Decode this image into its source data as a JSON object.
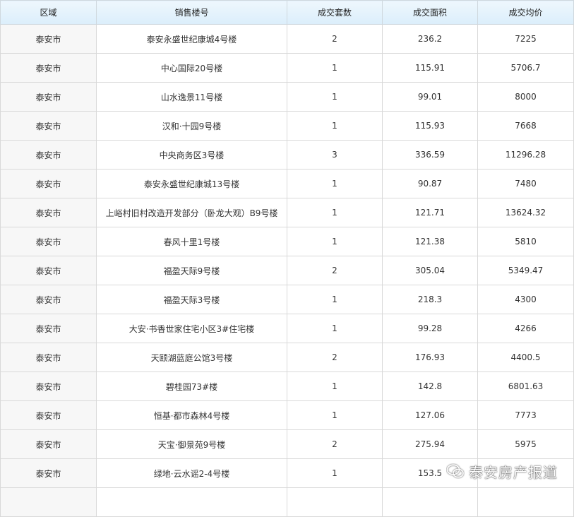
{
  "table": {
    "headers": [
      "区域",
      "销售楼号",
      "成交套数",
      "成交面积",
      "成交均价"
    ],
    "rows": [
      [
        "泰安市",
        "泰安永盛世纪康城4号楼",
        "2",
        "236.2",
        "7225"
      ],
      [
        "泰安市",
        "中心国际20号楼",
        "1",
        "115.91",
        "5706.7"
      ],
      [
        "泰安市",
        "山水逸景11号楼",
        "1",
        "99.01",
        "8000"
      ],
      [
        "泰安市",
        "汉和·十园9号楼",
        "1",
        "115.93",
        "7668"
      ],
      [
        "泰安市",
        "中央商务区3号楼",
        "3",
        "336.59",
        "11296.28"
      ],
      [
        "泰安市",
        "泰安永盛世纪康城13号楼",
        "1",
        "90.87",
        "7480"
      ],
      [
        "泰安市",
        "上峪村旧村改造开发部分（卧龙大观）B9号楼",
        "1",
        "121.71",
        "13624.32"
      ],
      [
        "泰安市",
        "春风十里1号楼",
        "1",
        "121.38",
        "5810"
      ],
      [
        "泰安市",
        "福盈天际9号楼",
        "2",
        "305.04",
        "5349.47"
      ],
      [
        "泰安市",
        "福盈天际3号楼",
        "1",
        "218.3",
        "4300"
      ],
      [
        "泰安市",
        "大安·书香世家住宅小区3#住宅楼",
        "1",
        "99.28",
        "4266"
      ],
      [
        "泰安市",
        "天颐湖蓝庭公馆3号楼",
        "2",
        "176.93",
        "4400.5"
      ],
      [
        "泰安市",
        "碧桂园73#楼",
        "1",
        "142.8",
        "6801.63"
      ],
      [
        "泰安市",
        "恒基·都市森林4号楼",
        "1",
        "127.06",
        "7773"
      ],
      [
        "泰安市",
        "天宝·御景苑9号楼",
        "2",
        "275.94",
        "5975"
      ],
      [
        "泰安市",
        "绿地·云水谣2-4号楼",
        "1",
        "153.5",
        ""
      ],
      [
        "",
        "",
        "",
        "",
        ""
      ]
    ]
  },
  "watermark": {
    "text": "泰安房产报道",
    "icon": "wechat-icon"
  }
}
